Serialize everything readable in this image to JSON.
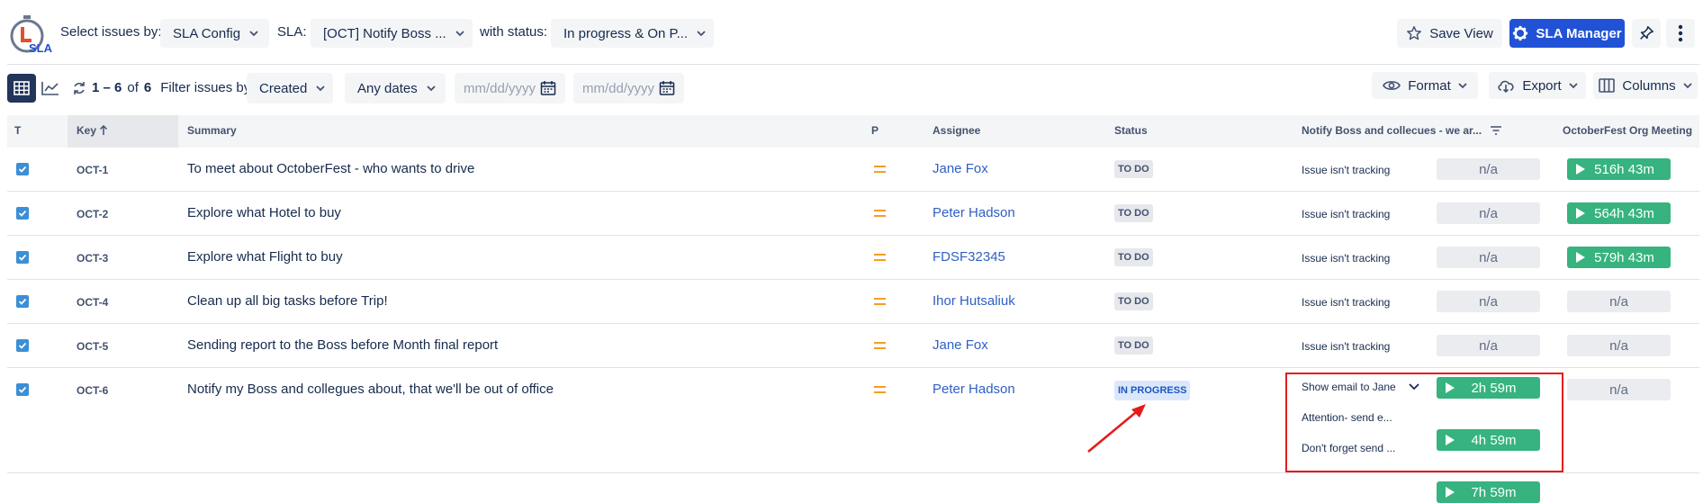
{
  "toolbar": {
    "select_issues_label": "Select issues by:",
    "select_issues_value": "SLA Config",
    "sla_label": "SLA:",
    "sla_value": "[OCT] Notify Boss ...",
    "with_status_label": "with status:",
    "with_status_value": "In progress & On P...",
    "save_view": "Save View",
    "sla_manager": "SLA Manager",
    "logo_text": "SLA"
  },
  "toolbar2": {
    "count_range": "1 – 6",
    "count_of": "of",
    "count_total": "6",
    "filter_label": "Filter issues by:",
    "filter_field": "Created",
    "filter_dates": "Any dates",
    "date_from_placeholder": "mm/dd/yyyy",
    "date_to_placeholder": "mm/dd/yyyy",
    "format": "Format",
    "export": "Export",
    "columns": "Columns"
  },
  "table": {
    "headers": {
      "t": "T",
      "key": "Key",
      "summary": "Summary",
      "p": "P",
      "assignee": "Assignee",
      "status": "Status",
      "sla1": "Notify Boss and collecues - we ar...",
      "sla2": "OctoberFest Org Meeting"
    },
    "rows": [
      {
        "key": "OCT-1",
        "summary": "To meet about OctoberFest - who wants to drive",
        "assignee": "Jane Fox",
        "status": "TO DO",
        "sla_label": "Issue isn't tracking",
        "sla1": "n/a",
        "sla2": "516h 43m"
      },
      {
        "key": "OCT-2",
        "summary": "Explore what Hotel to buy",
        "assignee": "Peter Hadson",
        "status": "TO DO",
        "sla_label": "Issue isn't tracking",
        "sla1": "n/a",
        "sla2": "564h 43m"
      },
      {
        "key": "OCT-3",
        "summary": "Explore what Flight to buy",
        "assignee": "FDSF32345",
        "status": "TO DO",
        "sla_label": "Issue isn't tracking",
        "sla1": "n/a",
        "sla2": "579h 43m"
      },
      {
        "key": "OCT-4",
        "summary": "Clean up all big tasks before Trip!",
        "assignee": "Ihor Hutsaliuk",
        "status": "TO DO",
        "sla_label": "Issue isn't tracking",
        "sla1": "n/a",
        "sla2": "n/a"
      },
      {
        "key": "OCT-5",
        "summary": "Sending report to the Boss before Month final report",
        "assignee": "Jane Fox",
        "status": "TO DO",
        "sla_label": "Issue isn't tracking",
        "sla1": "n/a",
        "sla2": "n/a"
      },
      {
        "key": "OCT-6",
        "summary": "Notify my Boss and collegues about, that we'll be out of office",
        "assignee": "Peter Hadson",
        "status": "IN PROGRESS",
        "sla_items": [
          {
            "label": "Show email to Jane",
            "value": "2h 59m"
          },
          {
            "label": "Attention- send e...",
            "value": "4h 59m"
          },
          {
            "label": "Don't forget send ...",
            "value": "7h 59m"
          }
        ],
        "sla2": "n/a"
      }
    ]
  },
  "colors": {
    "primary": "#2152d6",
    "timer_green": "#36b37e",
    "highlight_red": "#e31b1b",
    "priority_orange": "#f59d22"
  }
}
